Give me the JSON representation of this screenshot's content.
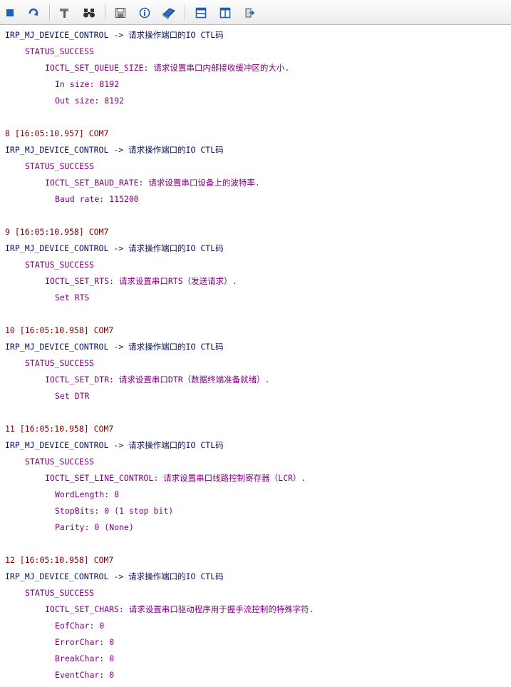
{
  "toolbar": {
    "buttons": [
      {
        "name": "stop-icon",
        "color": "#1f5fb8"
      },
      {
        "name": "refresh-icon",
        "color": "#1f5fb8"
      },
      {
        "name": "settings-hammer-icon",
        "color": "#6b6b6b"
      },
      {
        "name": "find-binoculars-icon",
        "color": "#333333"
      },
      {
        "name": "save-icon",
        "color": "#6b6b6b"
      },
      {
        "name": "info-icon",
        "color": "#1f5fb8"
      },
      {
        "name": "help-book-icon",
        "color": "#1f5fb8"
      },
      {
        "name": "layout-horizontal-icon",
        "color": "#1f5fb8"
      },
      {
        "name": "layout-vertical-icon",
        "color": "#1f5fb8"
      },
      {
        "name": "exit-icon",
        "color": "#1f5fb8"
      }
    ]
  },
  "log": {
    "entries": [
      {
        "timestamp": "",
        "irp": "IRP_MJ_DEVICE_CONTROL -> 请求操作端口的IO CTL码",
        "status": "STATUS_SUCCESS",
        "ioctl": "IOCTL_SET_QUEUE_SIZE: 请求设置串口内部接收缓冲区的大小.",
        "details": [
          "In size: 8192",
          "Out size: 8192"
        ]
      },
      {
        "timestamp": "8 [16:05:10.957] COM7",
        "irp": "IRP_MJ_DEVICE_CONTROL -> 请求操作端口的IO CTL码",
        "status": "STATUS_SUCCESS",
        "ioctl": "IOCTL_SET_BAUD_RATE: 请求设置串口设备上的波特率.",
        "details": [
          "Baud rate: 115200"
        ]
      },
      {
        "timestamp": "9 [16:05:10.958] COM7",
        "irp": "IRP_MJ_DEVICE_CONTROL -> 请求操作端口的IO CTL码",
        "status": "STATUS_SUCCESS",
        "ioctl": "IOCTL_SET_RTS: 请求设置串口RTS（发送请求）.",
        "details": [
          "Set RTS"
        ]
      },
      {
        "timestamp": "10 [16:05:10.958] COM7",
        "irp": "IRP_MJ_DEVICE_CONTROL -> 请求操作端口的IO CTL码",
        "status": "STATUS_SUCCESS",
        "ioctl": "IOCTL_SET_DTR: 请求设置串口DTR（数据终端准备就绪）.",
        "details": [
          "Set DTR"
        ]
      },
      {
        "timestamp": "11 [16:05:10.958] COM7",
        "irp": "IRP_MJ_DEVICE_CONTROL -> 请求操作端口的IO CTL码",
        "status": "STATUS_SUCCESS",
        "ioctl": "IOCTL_SET_LINE_CONTROL: 请求设置串口线路控制寄存器（LCR）.",
        "details": [
          "WordLength: 8",
          "StopBits: 0 (1 stop bit)",
          "Parity: 0 (None)"
        ]
      },
      {
        "timestamp": "12 [16:05:10.958] COM7",
        "irp": "IRP_MJ_DEVICE_CONTROL -> 请求操作端口的IO CTL码",
        "status": "STATUS_SUCCESS",
        "ioctl": "IOCTL_SET_CHARS: 请求设置串口驱动程序用于握手流控制的特殊字符.",
        "details": [
          "EofChar: 0",
          "ErrorChar: 0",
          "BreakChar: 0",
          "EventChar: 0"
        ]
      }
    ]
  }
}
